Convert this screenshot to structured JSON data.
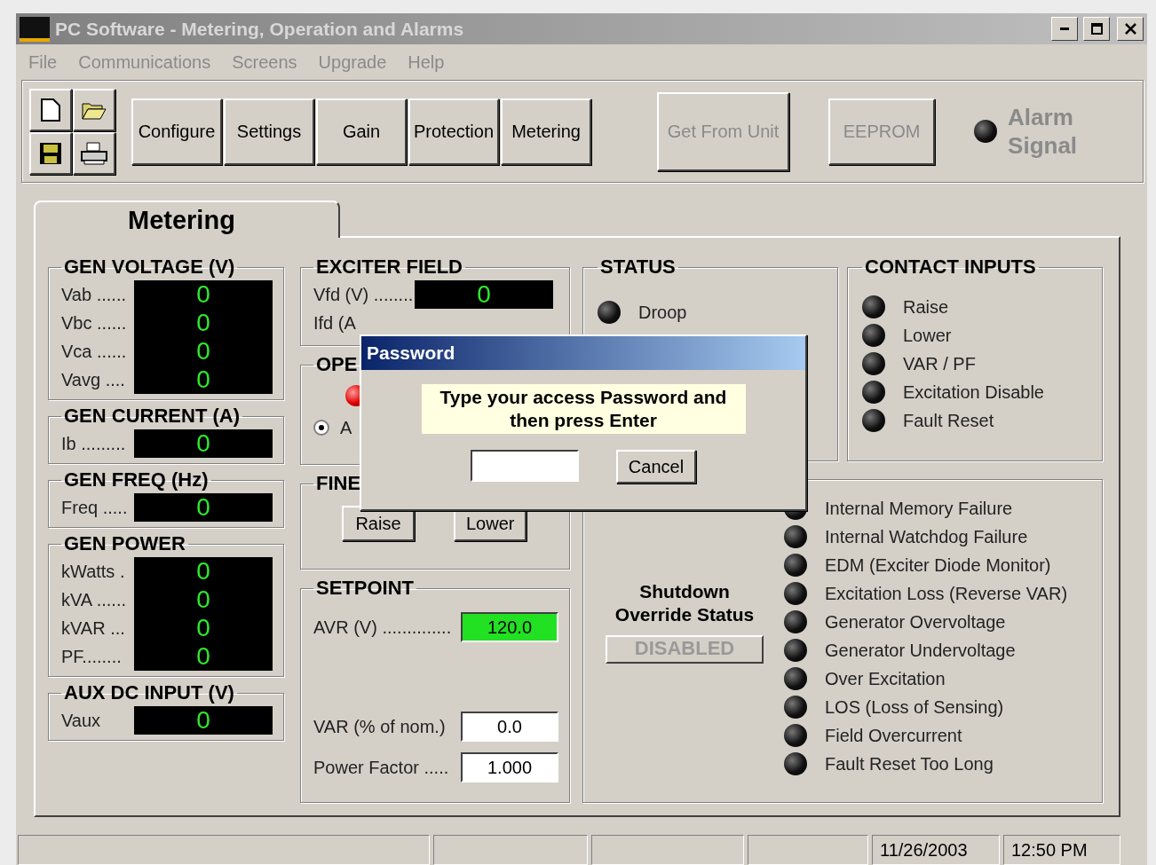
{
  "window": {
    "title": "PC Software - Metering, Operation and Alarms",
    "active": false
  },
  "menu": [
    "File",
    "Communications",
    "Screens",
    "Upgrade",
    "Help"
  ],
  "toolbar": {
    "file_buttons": [
      {
        "kind": "new"
      },
      {
        "kind": "open"
      },
      {
        "kind": "save"
      },
      {
        "kind": "print"
      }
    ],
    "screen_buttons": [
      "Configure",
      "Settings",
      "Gain",
      "Protection",
      "Metering"
    ],
    "unit_buttons": [
      {
        "label": "Get From Unit",
        "disabled": true,
        "kind": "large"
      },
      {
        "label": "EEPROM",
        "disabled": true,
        "kind": "small"
      }
    ],
    "alarm_signal": {
      "label": "Alarm Signal",
      "lit": false
    }
  },
  "tabs": [
    {
      "label": "Metering",
      "selected": true
    }
  ],
  "meter_groups": [
    {
      "title": "GEN VOLTAGE (V)",
      "rows": [
        {
          "label": "Vab ......",
          "value": "0"
        },
        {
          "label": "Vbc ......",
          "value": "0"
        },
        {
          "label": "Vca ......",
          "value": "0"
        },
        {
          "label": "Vavg ....",
          "value": "0"
        }
      ]
    },
    {
      "title": "GEN CURRENT (A)",
      "rows": [
        {
          "label": "Ib .........",
          "value": "0"
        }
      ]
    },
    {
      "title": "GEN FREQ (Hz)",
      "rows": [
        {
          "label": "Freq .....",
          "value": "0"
        }
      ]
    },
    {
      "title": "GEN POWER",
      "rows": [
        {
          "label": "kWatts .",
          "value": "0"
        },
        {
          "label": "kVA ......",
          "value": "0"
        },
        {
          "label": "kVAR ...",
          "value": "0"
        },
        {
          "label": "PF........",
          "value": "0"
        }
      ]
    },
    {
      "title": "AUX DC INPUT (V)",
      "rows": [
        {
          "label": "Vaux",
          "value": "0"
        }
      ]
    }
  ],
  "exciter_field": {
    "title": "EXCITER FIELD",
    "rows": [
      {
        "label": "Vfd (V) ........",
        "value": "0"
      },
      {
        "label": "Ifd (A"
      }
    ]
  },
  "operation": {
    "title": "OPE",
    "indicator_lit": true,
    "radios": [
      {
        "label": "A",
        "selected": true
      }
    ]
  },
  "fine_adjust": {
    "title": "FINE",
    "buttons": [
      "Raise",
      "Lower"
    ]
  },
  "setpoint": {
    "title": "SETPOINT",
    "fields": [
      {
        "label": "AVR (V) ..............",
        "value": "120.0",
        "active": true
      },
      {
        "label": "VAR (% of nom.)",
        "value": "0.0",
        "active": false
      },
      {
        "label": "Power Factor .....",
        "value": "1.000",
        "active": false
      }
    ]
  },
  "status": {
    "title": "STATUS",
    "items": [
      {
        "label": "Droop",
        "lit": false
      }
    ]
  },
  "contact_inputs": {
    "title": "CONTACT INPUTS",
    "items": [
      {
        "label": "Raise",
        "lit": false
      },
      {
        "label": "Lower",
        "lit": false
      },
      {
        "label": "VAR / PF",
        "lit": false
      },
      {
        "label": "Excitation Disable",
        "lit": false
      },
      {
        "label": "Fault Reset",
        "lit": false
      }
    ]
  },
  "shutdown_override": {
    "label": "Shutdown Override Status",
    "value": "DISABLED",
    "enabled": false
  },
  "alarms": [
    {
      "label": "Internal Memory Failure",
      "lit": false
    },
    {
      "label": "Internal Watchdog Failure",
      "lit": false
    },
    {
      "label": "EDM (Exciter Diode Monitor)",
      "lit": false
    },
    {
      "label": "Excitation Loss (Reverse VAR)",
      "lit": false
    },
    {
      "label": "Generator Overvoltage",
      "lit": false
    },
    {
      "label": "Generator Undervoltage",
      "lit": false
    },
    {
      "label": "Over Excitation",
      "lit": false
    },
    {
      "label": "LOS (Loss of Sensing)",
      "lit": false
    },
    {
      "label": "Field Overcurrent",
      "lit": false
    },
    {
      "label": "Fault Reset Too Long",
      "lit": false
    }
  ],
  "status_bar": {
    "date": "11/26/2003",
    "time": "12:50 PM"
  },
  "dialog": {
    "title": "Password",
    "message": "Type your access Password and then press Enter",
    "cancel": "Cancel"
  }
}
